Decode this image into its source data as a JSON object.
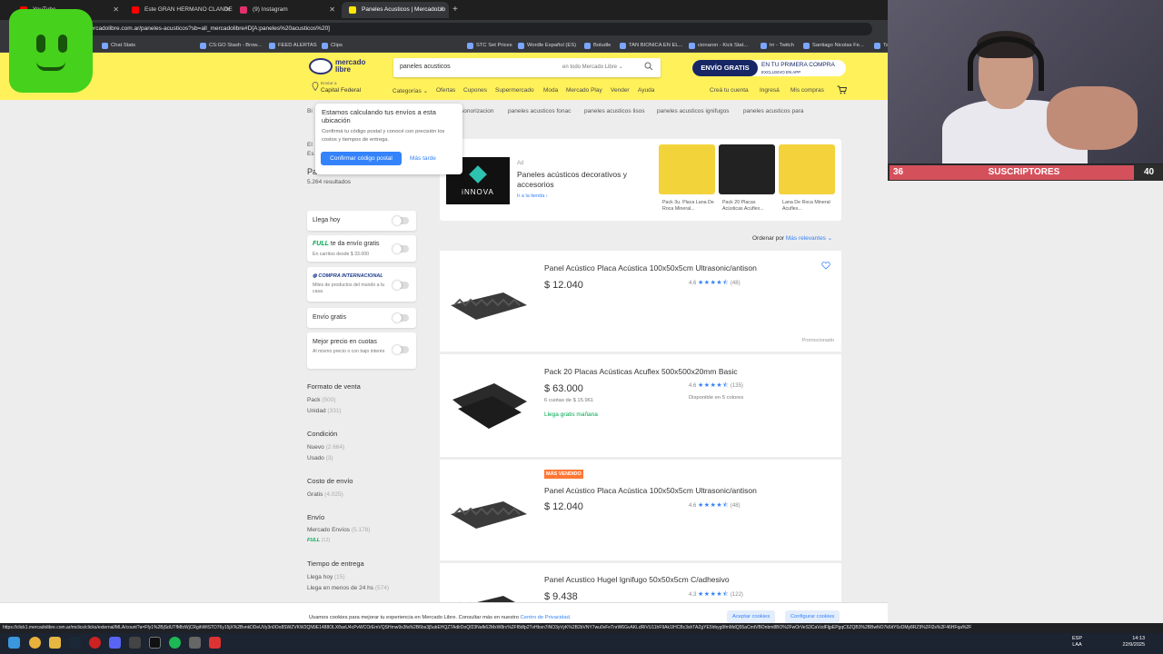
{
  "tabs": [
    {
      "label": "YouTube",
      "color": "#ff0000"
    },
    {
      "label": "Este GRAN HERMANO CLANDE",
      "color": "#ff0000"
    },
    {
      "label": "(9) Instagram",
      "color": "#e1306c"
    },
    {
      "label": "Paneles Acusticos | MercadoLib",
      "color": "#ffe600"
    }
  ],
  "address": {
    "url": "mercadolibre.com.ar/paneles-acusticos?sb=all_mercadolibre#D[A:paneles%20acusticos%20]"
  },
  "bookmarks": [
    "Chat Stats",
    "CS:GO Stash - Brow...",
    "FEED ALERTAS",
    "Clips",
    "STC Set Prices",
    "Wordle Español (ES)",
    "Boludle",
    "TAN BIONICA EN EL...",
    "cionaron - Kick Stat...",
    "trr - Twitch",
    "Santiago Nicolas Fe...",
    "Ta"
  ],
  "header": {
    "logo_line1": "mercado",
    "logo_line2": "libre",
    "search_value": "paneles acusticos",
    "search_scope": "en todo Mercado Libre",
    "promo_left": "ENVÍO GRATIS",
    "promo_right1": "EN TU PRIMERA COMPRA",
    "promo_right2": "EXCLUSIVO EN APP",
    "loc_label": "Enviar a",
    "loc_value": "Capital Federal",
    "nav": [
      "Categorías",
      "Ofertas",
      "Cupones",
      "Supermercado",
      "Moda",
      "Mercado Play",
      "Vender",
      "Ayuda"
    ],
    "account": [
      "Creá tu cuenta",
      "Ingresá",
      "Mis compras"
    ]
  },
  "popup": {
    "title": "Estamos calculando tus envíos a esta ubicación",
    "desc": "Confirmá tu código postal y conocé con precisión los costos y tiempos de entrega.",
    "confirm": "Confirmar código postal",
    "later": "Más tarde"
  },
  "breadcrumbs": [
    "sonorizacion",
    "paneles acusticos fonac",
    "paneles acusticos lisos",
    "paneles acusticos ignifugos",
    "paneles acusticos para"
  ],
  "left": {
    "b_frag": "Bi",
    "el_frag": "El",
    "es_frag": "Es",
    "title_frag": "Pa",
    "results": "5.264 resultados",
    "toggles": [
      {
        "label": "Llega hoy",
        "sub": ""
      },
      {
        "label": "te da envío gratis",
        "full": "FULL",
        "sub": "En carritos desde $ 33.000"
      },
      {
        "label": "COMPRA INTERNACIONAL",
        "sub": "Miles de productos del mundo a tu casa"
      },
      {
        "label": "Envío gratis",
        "sub": ""
      },
      {
        "label": "Mejor precio en cuotas",
        "sub": "Al mismo precio o con bajo interés"
      }
    ],
    "sections": [
      {
        "title": "Formato de venta",
        "options": [
          {
            "label": "Pack",
            "count": "(500)"
          },
          {
            "label": "Unidad",
            "count": "(331)"
          }
        ]
      },
      {
        "title": "Condición",
        "options": [
          {
            "label": "Nuevo",
            "count": "(2.664)"
          },
          {
            "label": "Usado",
            "count": "(3)"
          }
        ]
      },
      {
        "title": "Costo de envío",
        "options": [
          {
            "label": "Gratis",
            "count": "(4.025)"
          }
        ]
      },
      {
        "title": "Envío",
        "options": [
          {
            "label": "Mercado Envíos",
            "count": "(5.178)"
          },
          {
            "label": "FULL",
            "count": "(12)"
          }
        ]
      },
      {
        "title": "Tiempo de entrega",
        "options": [
          {
            "label": "Llega hoy",
            "count": "(15)"
          },
          {
            "label": "Llega en menos de 24 hs",
            "count": "(574)"
          }
        ]
      }
    ]
  },
  "ad": {
    "brand": "iNNOVA",
    "tag": "Ad",
    "title": "Paneles acústicos decorativos y accesorios",
    "link": "Ir a la tienda",
    "products": [
      {
        "caption": "Pack 3u. Placa Lana De Roca Mineral...",
        "color": "#f2d43a"
      },
      {
        "caption": "Pack 20 Placas Acústicas Acuflex...",
        "color": "#222222"
      },
      {
        "caption": "Lana De Roca Mineral Acuflex...",
        "color": "#f3d23c"
      }
    ]
  },
  "sort": {
    "label": "Ordenar por",
    "value": "Más relevantes"
  },
  "products": [
    {
      "title": "Panel Acústico Placa Acústica 100x50x5cm Ultrasonic/antison",
      "price": "$ 12.040",
      "rating": "4.6",
      "reviews": "(48)",
      "promoted": "Promocionado",
      "extra": "",
      "free": "",
      "badge": ""
    },
    {
      "title": "Pack 20 Placas Acústicas Acuflex 500x500x20mm Basic",
      "price": "$ 63.000",
      "rating": "4.6",
      "reviews": "(135)",
      "promoted": "",
      "extra": "6 cuotas de $ 15.961",
      "free": "Llega gratis mañana",
      "colors": "Disponible en 5 colores",
      "badge": ""
    },
    {
      "title": "Panel Acústico Placa Acústica 100x50x5cm Ultrasonic/antison",
      "price": "$ 12.040",
      "rating": "4.6",
      "reviews": "(48)",
      "promoted": "",
      "extra": "",
      "free": "",
      "badge": "MÁS VENDIDO"
    },
    {
      "title": "Panel Acustico Hugel Ignifugo 50x50x5cm C/adhesivo",
      "price": "$ 9.438",
      "rating": "4.3",
      "reviews": "(122)",
      "promoted": "",
      "extra": "",
      "free": "",
      "badge": ""
    }
  ],
  "cookie": {
    "text": "Usamos cookies para mejorar tu experiencia en Mercado Libre. Consultar más en nuestro",
    "privacy": "Centro de Privacidad.",
    "accept": "Aceptar cookies",
    "configure": "Configurar cookies"
  },
  "status_url": "https://click1.mercadolibre.com.ar/mclics/clicks/external/MLA/count?a=Ffy1%2BjSdUTfMfzWjCRgihWtSTD76y15jX%2BvnkDDeUVy3n0Oo8SWZVKW2QN9E1488OLXf/axU4cPvWCOrEmVQSHmw9x3fa%2B6bs3j5ubEHQZTAdlrDoQf23Nafk62MxW8rc%2Ff8dfp2TvHbsn7iNO3yVyK%2B2bVNY7wu0vFeTnrW6GvAKLdRiVU11hF9Ak1IHCBc3shTAZgYE5lrbyg9fmMdQ55aCmtVBOnbm8BO%2FwOrVeS3CaVzdFljpEPgqC6ZQB3%2BBwNO7k6itY0zDMy8RZ9%2Fl2s%2F46HFqa%2F",
  "taskbar": {
    "lang1": "ESP",
    "lang2": "LAA",
    "time": "14:13",
    "date": "22/9/2025"
  },
  "stream": {
    "left": "36",
    "label": "SUSCRIPTORES",
    "right": "40",
    "progress": 0.9
  }
}
